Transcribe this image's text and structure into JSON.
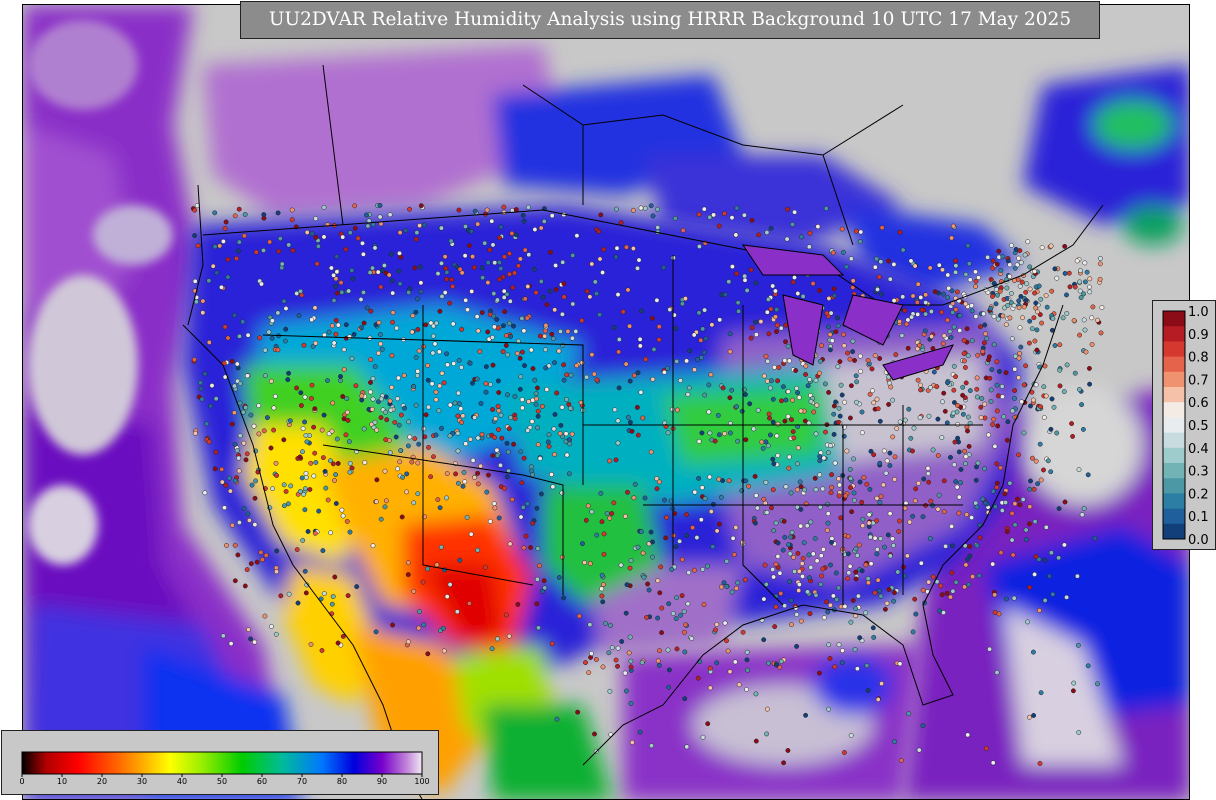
{
  "title": "UU2DVAR Relative Humidity Analysis using HRRR Background 10 UTC 17 May 2025",
  "rh_scale": {
    "ticks": [
      "0",
      "10",
      "20",
      "30",
      "40",
      "50",
      "60",
      "70",
      "80",
      "90",
      "100"
    ],
    "colors": [
      "#000000",
      "#b00000",
      "#ff0000",
      "#ff6600",
      "#ffaa00",
      "#ffff00",
      "#99ee00",
      "#00cc00",
      "#00bb99",
      "#0077ff",
      "#0000dd",
      "#7700cc",
      "#aa44cc",
      "#f0e8f4"
    ]
  },
  "obs_scale": {
    "ticks": [
      "1.0",
      "0.9",
      "0.8",
      "0.7",
      "0.6",
      "0.5",
      "0.4",
      "0.3",
      "0.2",
      "0.1",
      "0.0"
    ],
    "colors": [
      "#8b0b16",
      "#b51c24",
      "#d4382e",
      "#e4634a",
      "#ee9270",
      "#f5c1a8",
      "#f4ebe5",
      "#e8ecee",
      "#c8dcdf",
      "#9ecbcb",
      "#72b3b5",
      "#4c98a4",
      "#2d7ea4",
      "#1f5f9c",
      "#123f7a"
    ]
  },
  "map": {
    "fill_gray": "#c8c8c8",
    "ocean_purple": "#7a1fb8",
    "deep_blue": "#1a18d8"
  }
}
